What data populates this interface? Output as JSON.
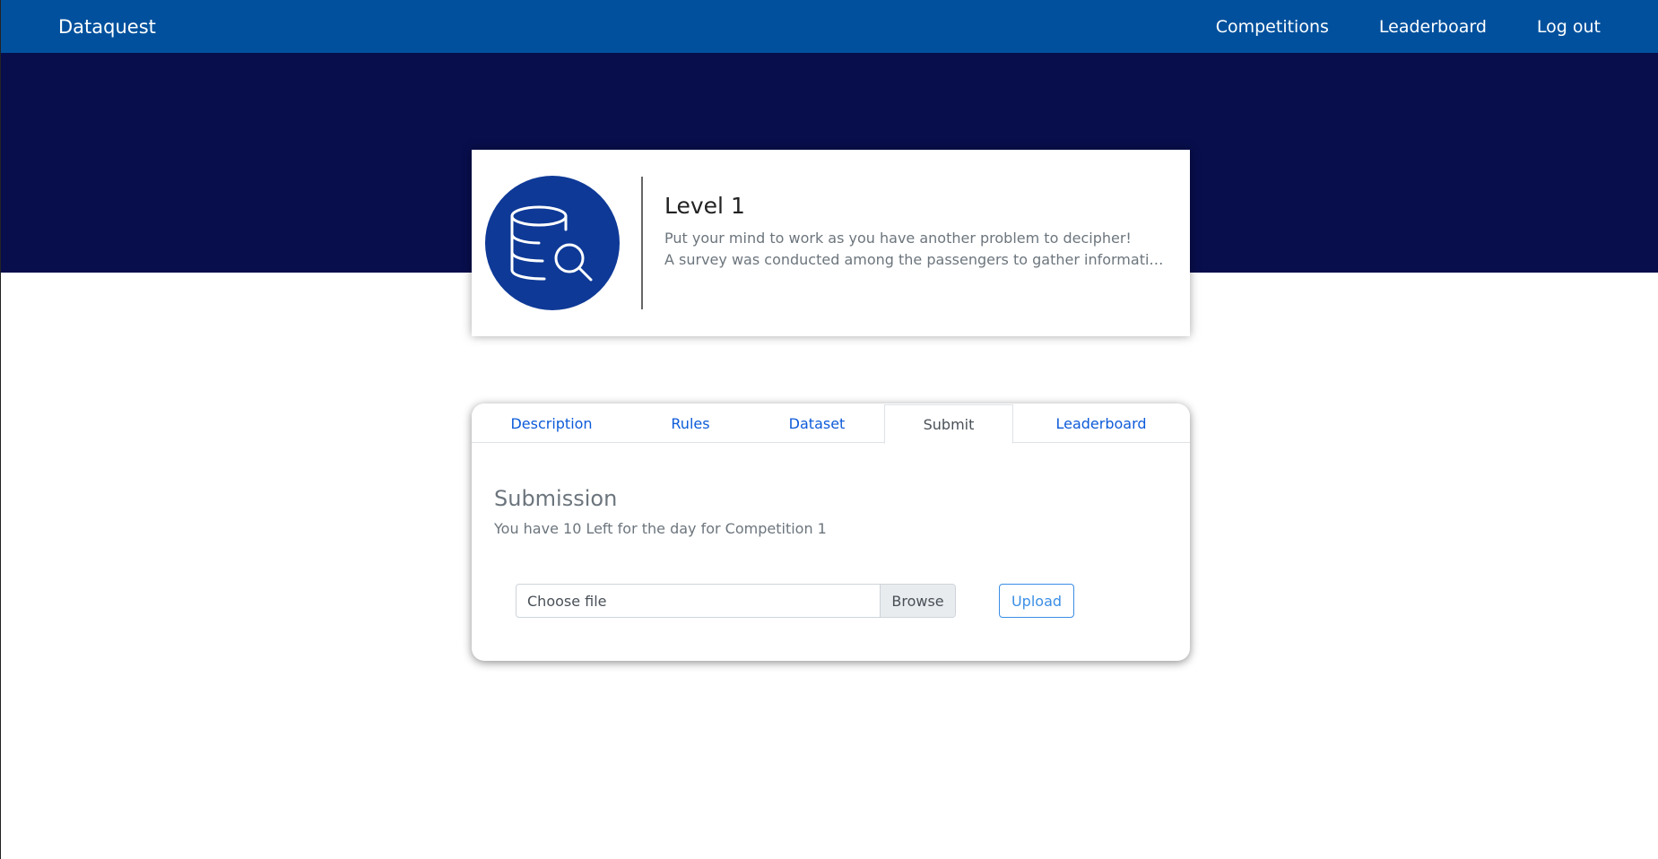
{
  "navbar": {
    "brand": "Dataquest",
    "links": [
      "Competitions",
      "Leaderboard",
      "Log out"
    ],
    "background": "#00509d"
  },
  "hero": {
    "background": "#070e4b"
  },
  "level": {
    "icon": "database-search-icon",
    "title": "Level 1",
    "line1": "Put your mind to work as you have another problem to decipher!",
    "line2": "A survey was conducted among the passengers to gather informatio..."
  },
  "tabs": {
    "items": [
      "Description",
      "Rules",
      "Dataset",
      "Submit",
      "Leaderboard"
    ],
    "active": "Submit"
  },
  "submission": {
    "title": "Submission",
    "info": "You have 10 Left for the day for Competition 1",
    "file_label": "Choose file",
    "browse_label": "Browse",
    "upload_label": "Upload"
  }
}
